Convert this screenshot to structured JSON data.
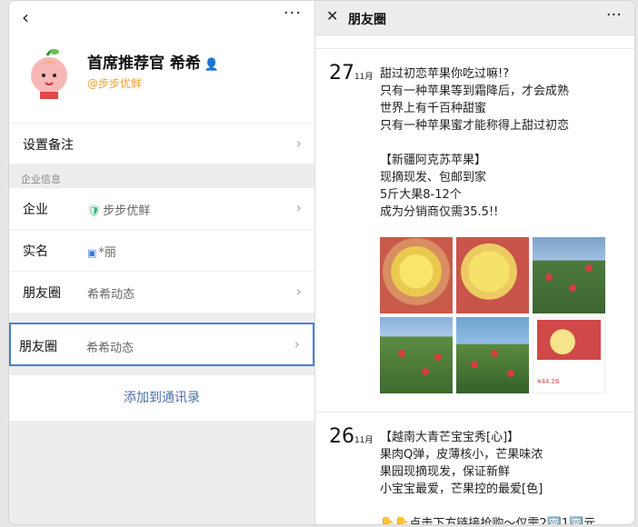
{
  "left": {
    "back": "‹",
    "more": "···",
    "profile": {
      "name": "首席推荐官 希希",
      "org": "@步步优鲜"
    },
    "remark_row": {
      "label": "设置备注",
      "chev": "›"
    },
    "section_title": "企业信息",
    "company_row": {
      "label": "企业",
      "value": "步步优鲜",
      "chev": "›"
    },
    "realname_row": {
      "label": "实名",
      "value": "*丽"
    },
    "moments_row": {
      "label": "朋友圈",
      "value": "希希动态",
      "chev": "›"
    },
    "moments_row_selected": {
      "label": "朋友圈",
      "value": "希希动态",
      "chev": "›"
    },
    "add_button": "添加到通讯录"
  },
  "right": {
    "close": "✕",
    "title": "朋友圈",
    "more": "···",
    "posts": [
      {
        "day": "27",
        "month": "11月",
        "text": "甜过初恋苹果你吃过嘛!?\n只有一种苹果等到霜降后，才会成熟\n世界上有千百种甜蜜\n只有一种苹果蜜才能称得上甜过初恋\n\n【新疆阿克苏苹果】\n现摘现发、包邮到家\n5斤大果8-12个\n成为分销商仅需35.5!!",
        "product_price": "¥44.26"
      },
      {
        "day": "26",
        "month": "11月",
        "text": "【越南大青芒宝宝秀[心]】\n果肉Q弹，皮薄核小，芒果味浓\n果园现摘现发，保证新鲜\n小宝宝最爱，芒果控的最爱[色]\n\n👇👇点击下方链接抢购～仅需2🈳1🈳元"
      }
    ]
  }
}
